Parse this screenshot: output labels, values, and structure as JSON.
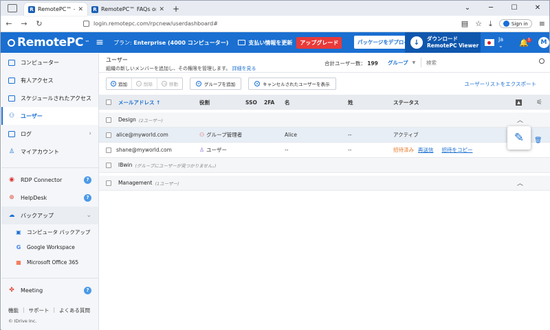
{
  "browser": {
    "tabs": [
      {
        "label": "RemotePC™ - ユーザー管理",
        "active": true
      },
      {
        "label": "RemotePC™ FAQs on Security",
        "active": false
      }
    ],
    "url": "login.remotepc.com/rpcnew/userdashboard#",
    "signin_label": "Sign in"
  },
  "header": {
    "logo": "RemotePC",
    "logo_tm": "™",
    "plan_prefix": "プラン:",
    "plan_value": "Enterprise (4000 コンピューター)",
    "payment_label": "支払い情報を更新",
    "upgrade_label": "アップグレード",
    "deploy_label": "パッケージをデプロイ",
    "download_line1": "ダウンロード",
    "download_line2": "RemotePC Viewer",
    "language": "Ja",
    "notification_count": "1",
    "avatar_initial": "M",
    "accent_color": "#1a6fd1"
  },
  "sidebar": {
    "items": [
      {
        "label": "コンピューター"
      },
      {
        "label": "有人アクセス"
      },
      {
        "label": "スケジュールされたアクセス"
      },
      {
        "label": "ユーザー"
      },
      {
        "label": "ログ"
      },
      {
        "label": "マイアカウント"
      },
      {
        "label": "RDP Connector"
      },
      {
        "label": "HelpDesk"
      },
      {
        "label": "バックアップ"
      }
    ],
    "backup_sub": [
      {
        "label": "コンピュータ バックアップ"
      },
      {
        "label": "Google Workspace"
      },
      {
        "label": "Microsoft Office 365"
      }
    ],
    "meeting_label": "Meeting",
    "footer": [
      "機能",
      "サポート",
      "よくある質問"
    ],
    "copyright": "© IDrive Inc."
  },
  "main": {
    "title": "ユーザー",
    "subtitle": "組織の新しいメンバーを追加し、その権限を管理します。",
    "learn_more": "詳細を見る",
    "total_label": "合計ユーザー数：",
    "total_value": "199",
    "group_select": "グループ",
    "search_placeholder": "検索",
    "actions": {
      "add": "追加",
      "delete": "削除",
      "move": "移動",
      "add_group": "グループを追加",
      "show_cancelled": "キャンセルされたユーザーを表示",
      "export": "ユーザーリストをエクスポート"
    },
    "columns": {
      "email": "メールアドレス ↑",
      "role": "役割",
      "sso": "SSO",
      "twofa": "2FA",
      "first": "名",
      "last": "姓",
      "status": "ステータス"
    },
    "groups": [
      {
        "name": "Design",
        "count": "(2ユーザー)",
        "users": [
          {
            "email": "alice@myworld.com",
            "role": "グループ管理者",
            "first": "Alice",
            "last": "--",
            "status": "アクティブ"
          },
          {
            "email": "shane@myworld.com",
            "role": "ユーザー",
            "first": "--",
            "last": "--",
            "status": "招待済み",
            "resend": "再送信",
            "copy_invite": "招待をコピー"
          }
        ]
      },
      {
        "name": "IBwin",
        "count": "(グループにユーザーが見つかりません。)"
      },
      {
        "name": "Management",
        "count": "(1ユーザー)"
      }
    ]
  }
}
